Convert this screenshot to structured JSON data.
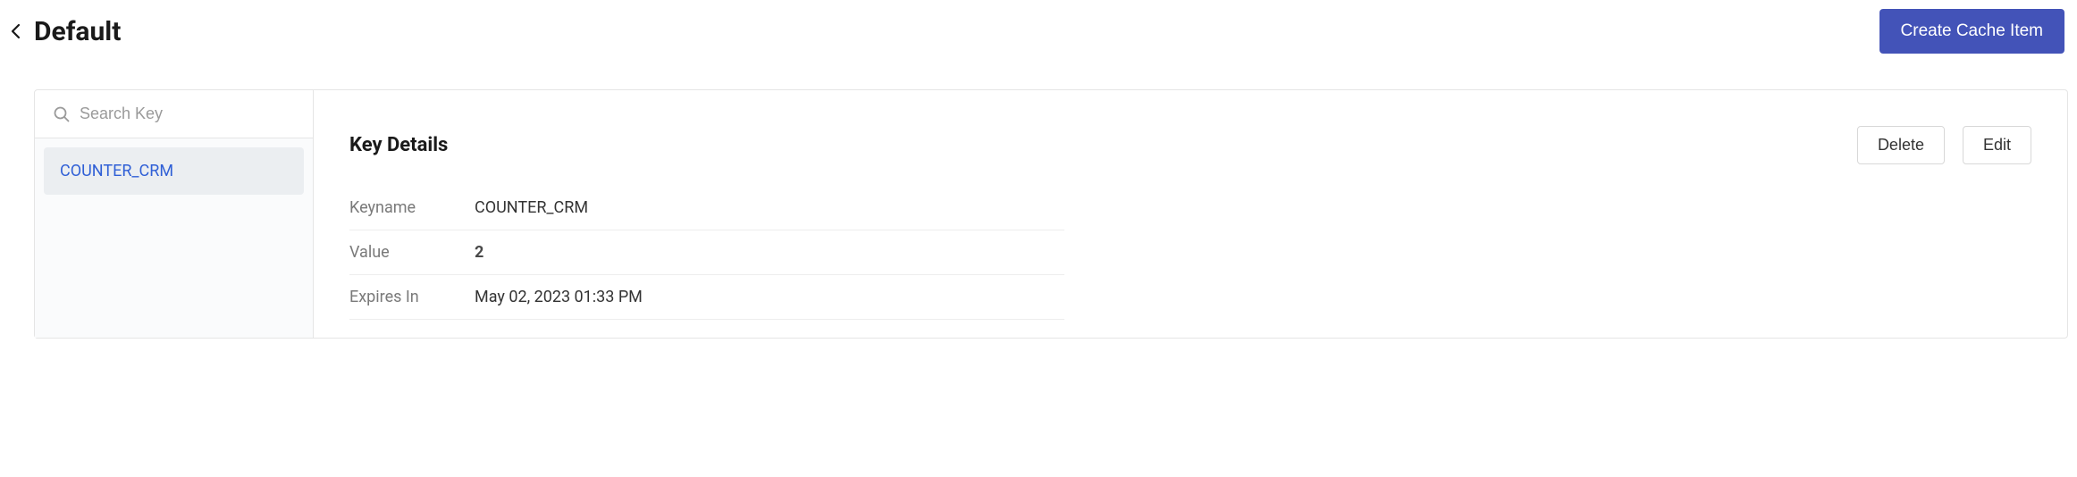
{
  "header": {
    "title": "Default",
    "create_button": "Create Cache Item"
  },
  "sidebar": {
    "search_placeholder": "Search Key",
    "items": [
      {
        "label": "COUNTER_CRM"
      }
    ]
  },
  "details": {
    "title": "Key Details",
    "delete_button": "Delete",
    "edit_button": "Edit",
    "rows": [
      {
        "label": "Keyname",
        "value": "COUNTER_CRM",
        "bold": false
      },
      {
        "label": "Value",
        "value": "2",
        "bold": true
      },
      {
        "label": "Expires In",
        "value": "May 02, 2023 01:33 PM",
        "bold": false
      }
    ]
  }
}
